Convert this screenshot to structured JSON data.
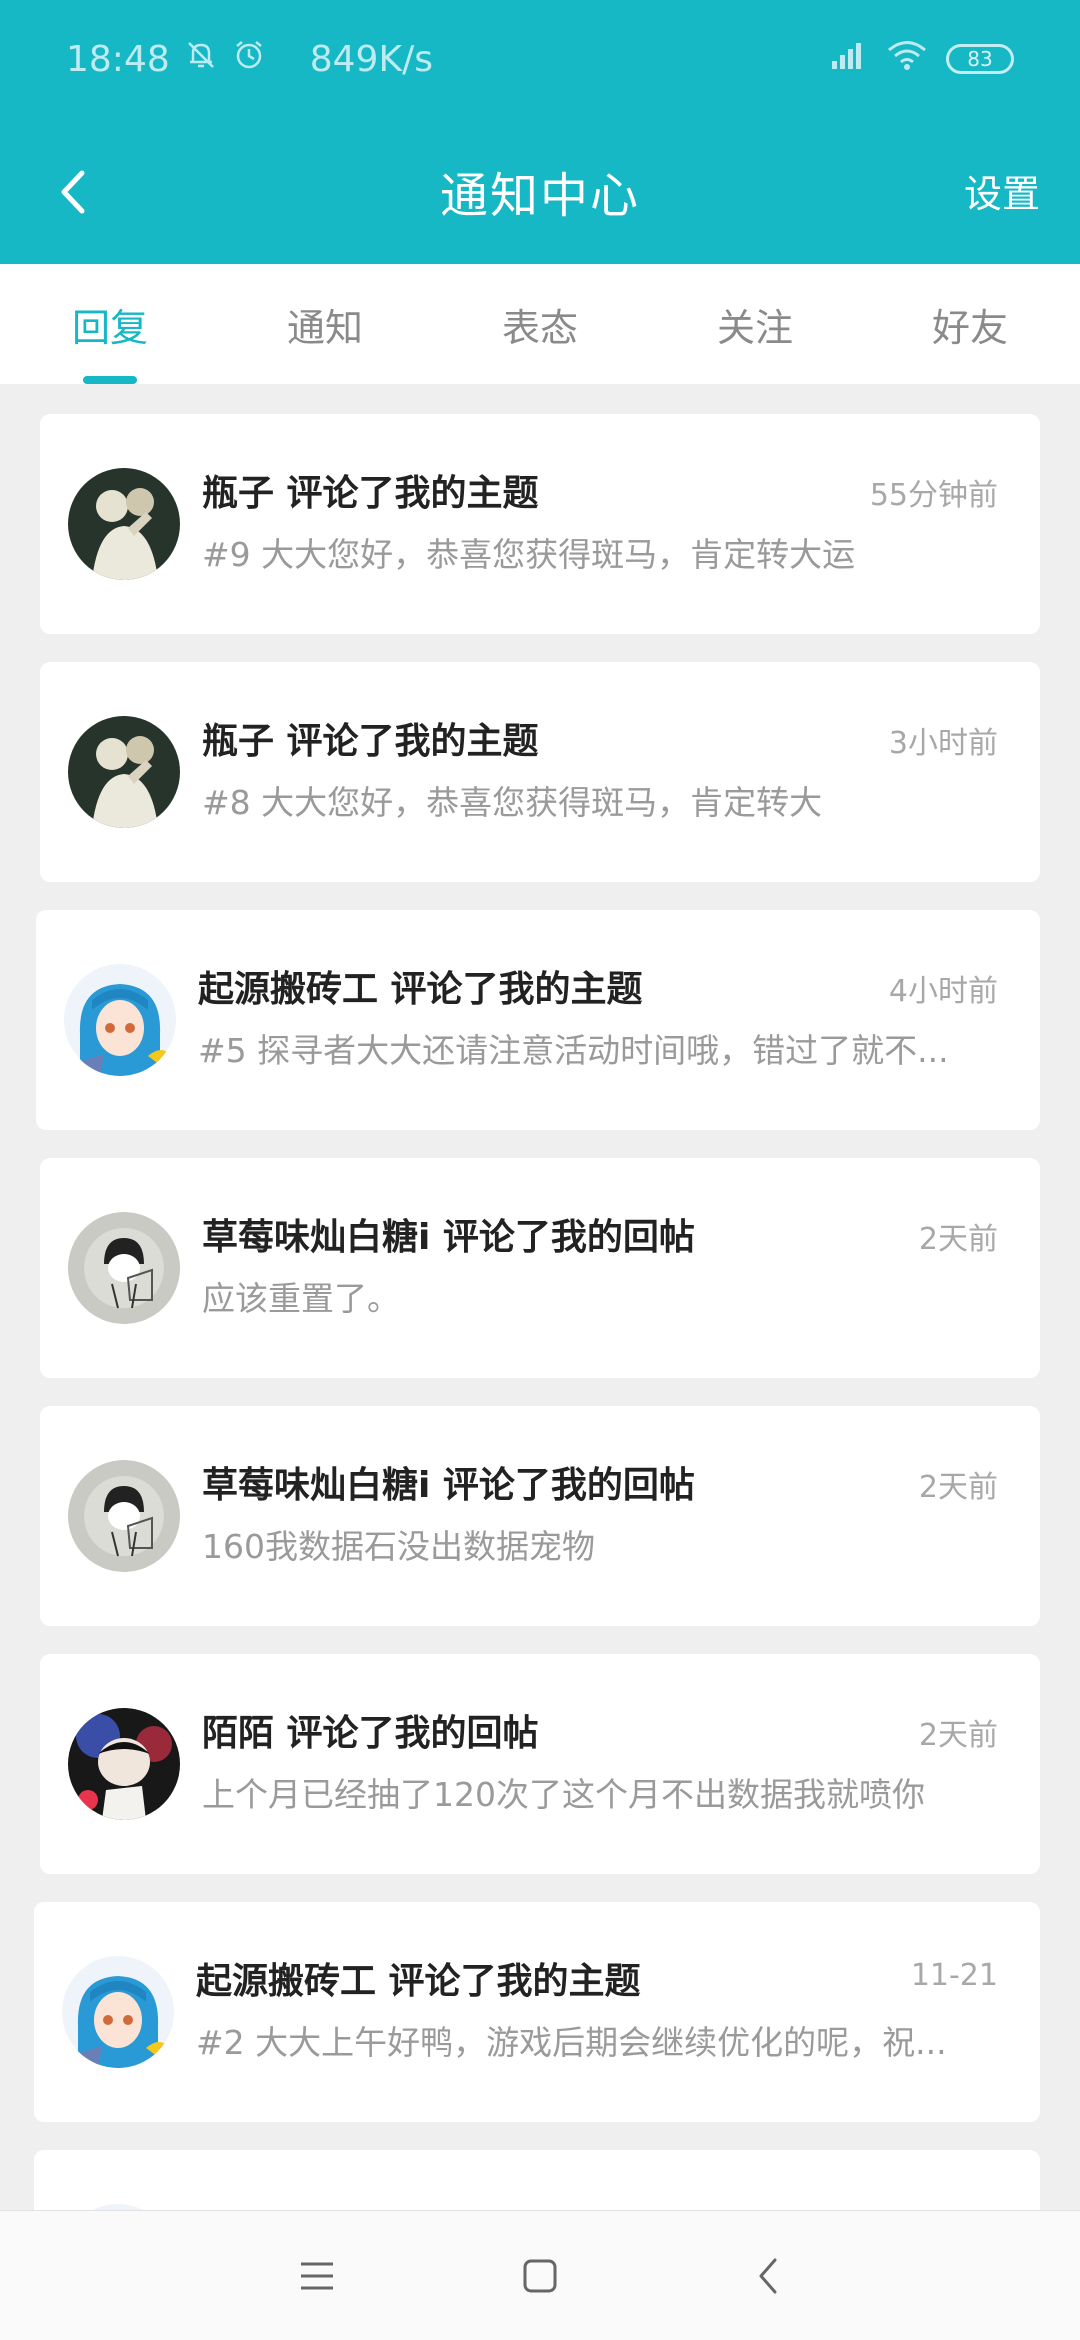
{
  "status_bar": {
    "time": "18:48",
    "speed": "849K/s",
    "battery": "83",
    "icons": [
      "bell-off-icon",
      "alarm-icon",
      "signal-icon",
      "wifi-icon",
      "battery-icon"
    ]
  },
  "header": {
    "title": "通知中心",
    "settings_label": "设置",
    "background": "#16b8c6"
  },
  "tabs": [
    {
      "label": "回复",
      "active": true
    },
    {
      "label": "通知",
      "active": false
    },
    {
      "label": "表态",
      "active": false
    },
    {
      "label": "关注",
      "active": false
    },
    {
      "label": "好友",
      "active": false
    }
  ],
  "notifications": [
    {
      "title": "瓶子 评论了我的主题",
      "time": "55分钟前",
      "preview": "#9 大大您好，恭喜您获得斑马，肯定转大运"
    },
    {
      "title": "瓶子 评论了我的主题",
      "time": "3小时前",
      "preview": "#8 大大您好，恭喜您获得斑马，肯定转大"
    },
    {
      "title": "起源搬砖工 评论了我的主题",
      "time": "4小时前",
      "preview": "#5 探寻者大大还请注意活动时间哦，错过了就不..."
    },
    {
      "title": "草莓味灿白糖i 评论了我的回帖",
      "time": "2天前",
      "preview": "应该重置了。"
    },
    {
      "title": "草莓味灿白糖i 评论了我的回帖",
      "time": "2天前",
      "preview": "160我数据石没出数据宠物"
    },
    {
      "title": "陌陌 评论了我的回帖",
      "time": "2天前",
      "preview": "上个月已经抽了120次了这个月不出数据我就喷你"
    },
    {
      "title": "起源搬砖工 评论了我的主题",
      "time": "11-21",
      "preview": "#2 大大上午好鸭，游戏后期会继续优化的呢，祝..."
    }
  ]
}
